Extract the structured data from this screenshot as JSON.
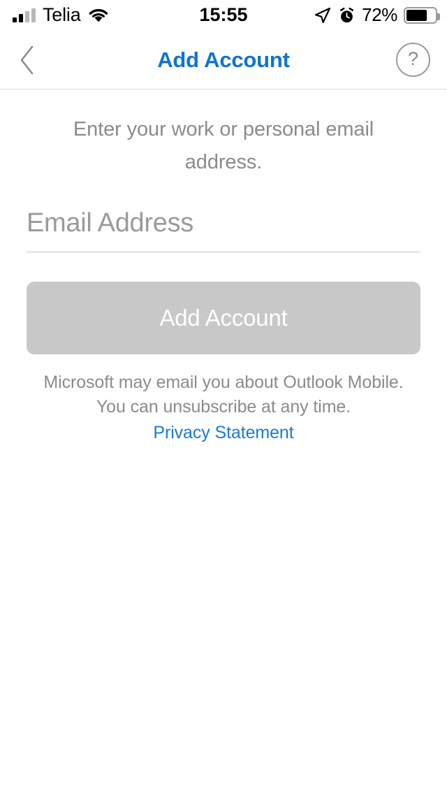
{
  "status_bar": {
    "carrier": "Telia",
    "time": "15:55",
    "battery_percent": "72%",
    "battery_level": 72,
    "signal_bars_filled": 2,
    "signal_bars_total": 4,
    "icons": {
      "wifi": "wifi-icon",
      "location": "location-arrow-icon",
      "alarm": "alarm-clock-icon",
      "battery": "battery-icon"
    }
  },
  "nav_bar": {
    "title": "Add Account",
    "back_icon": "chevron-left-icon",
    "help_label": "?",
    "title_color": "#0f74d0"
  },
  "main": {
    "instruction": "Enter your work or personal email address.",
    "email_field": {
      "placeholder": "Email Address",
      "value": ""
    },
    "submit_button": {
      "label": "Add Account",
      "enabled": false,
      "background": "#c8c8c8"
    },
    "disclaimer_line1": "Microsoft may email you about Outlook Mobile.",
    "disclaimer_line2": "You can unsubscribe at any time.",
    "privacy_link": "Privacy Statement",
    "link_color": "#1a7ad4"
  }
}
